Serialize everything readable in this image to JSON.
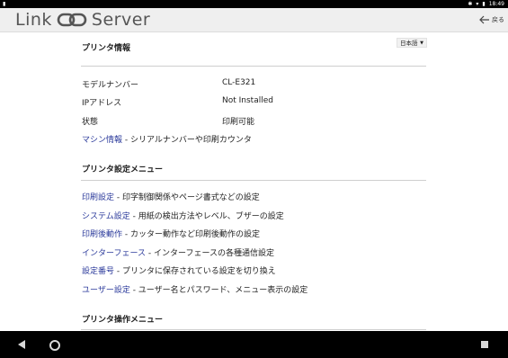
{
  "statusbar": {
    "time": "18:49"
  },
  "header": {
    "logo_left": "Link",
    "logo_right": "Server",
    "back_label": "戻る"
  },
  "language": {
    "selected": "日本語"
  },
  "printer_info": {
    "title": "プリンタ情報",
    "rows": [
      {
        "label": "モデルナンバー",
        "value": "CL-E321"
      },
      {
        "label": "IPアドレス",
        "value": "Not Installed"
      },
      {
        "label": "状態",
        "value": "印刷可能"
      }
    ],
    "machine_link": {
      "link": "マシン情報",
      "desc": " - シリアルナンバーや印刷カウンタ"
    }
  },
  "settings_menu": {
    "title": "プリンタ設定メニュー",
    "items": [
      {
        "link": "印刷設定",
        "desc": " - 印字制御関係やページ書式などの設定"
      },
      {
        "link": "システム設定",
        "desc": " - 用紙の検出方法やレベル、ブザーの設定"
      },
      {
        "link": "印刷後動作",
        "desc": " - カッター動作など印刷後動作の設定"
      },
      {
        "link": "インターフェース",
        "desc": " - インターフェースの各種通信設定"
      },
      {
        "link": "設定番号",
        "desc": " - プリンタに保存されている設定を切り換え"
      },
      {
        "link": "ユーザー設定",
        "desc": " - ユーザー名とパスワード、メニュー表示の設定"
      }
    ]
  },
  "operation_menu": {
    "title": "プリンタ操作メニュー"
  }
}
